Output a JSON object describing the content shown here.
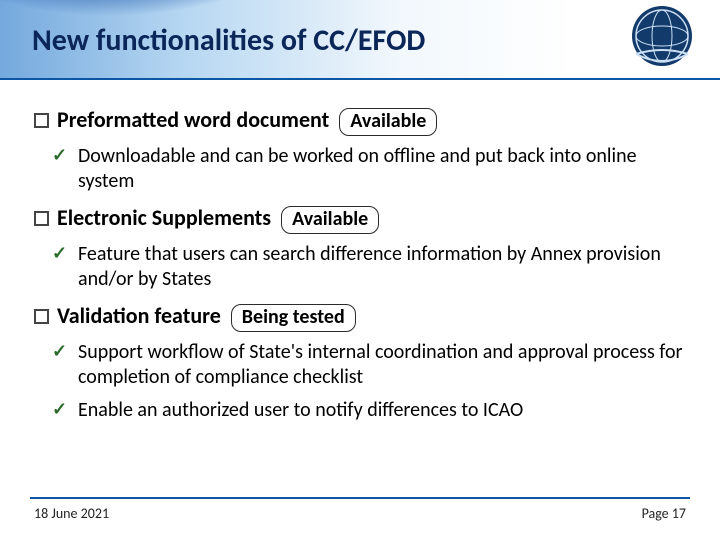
{
  "header": {
    "title": "New functionalities of CC/EFOD",
    "logo_alt": "ICAO emblem"
  },
  "sections": [
    {
      "label": "Preformatted word document",
      "status": "Available",
      "bullets": [
        "Downloadable and can be worked on offline and put back into online system"
      ]
    },
    {
      "label": "Electronic Supplements",
      "status": "Available",
      "bullets": [
        "Feature that users can search difference information by Annex provision and/or by States"
      ]
    },
    {
      "label": "Validation feature",
      "status": "Being tested",
      "bullets": [
        "Support workflow of State's internal coordination and approval process for completion of compliance checklist",
        "Enable an authorized user to notify differences to ICAO"
      ]
    }
  ],
  "footer": {
    "date": "18 June 2021",
    "page": "Page 17"
  }
}
